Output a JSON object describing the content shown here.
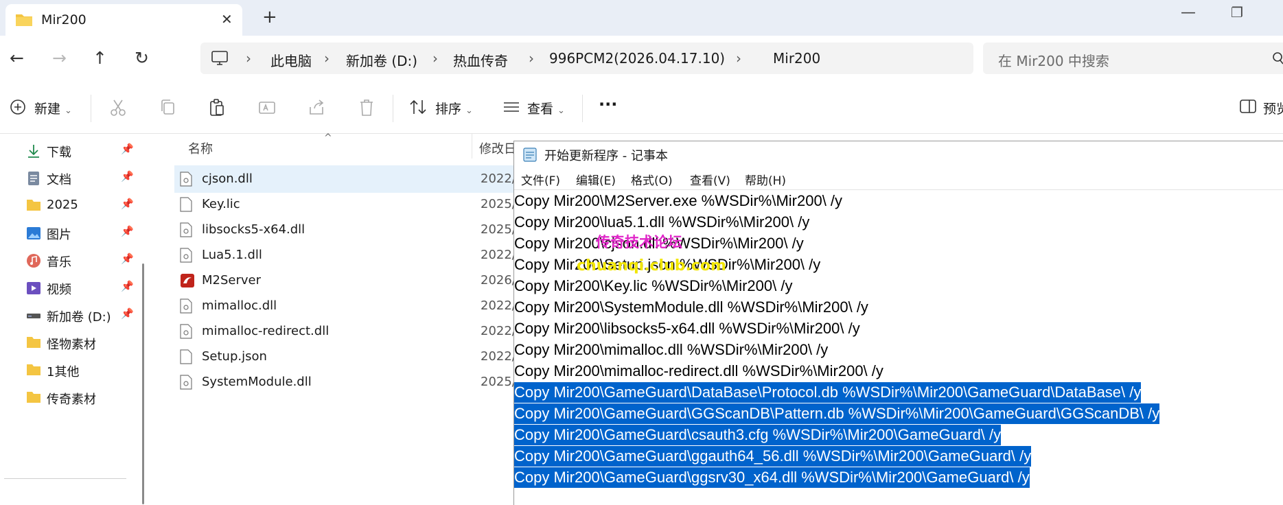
{
  "titlebar": {
    "tab_title": "Mir200",
    "tab_close": "✕",
    "new_tab": "+",
    "minimize": "—",
    "maximize": "❐"
  },
  "nav": {
    "back": "←",
    "forward": "→",
    "up": "↑",
    "refresh": "↻"
  },
  "breadcrumb": [
    "此电脑",
    "新加卷 (D:)",
    "热血传奇",
    "996PCM2(2026.04.17.10)",
    "Mir200"
  ],
  "breadcrumb_sep": "›",
  "search": {
    "placeholder": "在 Mir200 中搜索"
  },
  "toolbar": {
    "new_label": "新建",
    "sort_label": "排序",
    "view_label": "查看",
    "more_label": "···",
    "preview_label": "预览",
    "chevron": "⌄"
  },
  "sidebar": {
    "pin_glyph": "📌",
    "items": [
      {
        "label": "下载",
        "icon": "download-icon",
        "pinned": true
      },
      {
        "label": "文档",
        "icon": "document-icon",
        "pinned": true
      },
      {
        "label": "2025",
        "icon": "folder-icon",
        "pinned": true
      },
      {
        "label": "图片",
        "icon": "picture-icon",
        "pinned": true
      },
      {
        "label": "音乐",
        "icon": "music-icon",
        "pinned": true
      },
      {
        "label": "视频",
        "icon": "video-icon",
        "pinned": true
      },
      {
        "label": "新加卷 (D:)",
        "icon": "drive-icon",
        "pinned": true
      },
      {
        "label": "怪物素材",
        "icon": "folder-icon",
        "pinned": false
      },
      {
        "label": "1其他",
        "icon": "folder-icon",
        "pinned": false
      },
      {
        "label": "传奇素材",
        "icon": "folder-icon",
        "pinned": false
      }
    ]
  },
  "filelist": {
    "col_name": "名称",
    "col_date": "修改日",
    "sort_arrow": "^",
    "files": [
      {
        "name": "cjson.dll",
        "date": "2022/",
        "icon": "dll-file-icon",
        "selected": true
      },
      {
        "name": "Key.lic",
        "date": "2025/",
        "icon": "blank-file-icon",
        "selected": false
      },
      {
        "name": "libsocks5-x64.dll",
        "date": "2025/",
        "icon": "dll-file-icon",
        "selected": false
      },
      {
        "name": "Lua5.1.dll",
        "date": "2022/",
        "icon": "dll-file-icon",
        "selected": false
      },
      {
        "name": "M2Server",
        "date": "2026/",
        "icon": "m2server-app-icon",
        "selected": false
      },
      {
        "name": "mimalloc.dll",
        "date": "2022/",
        "icon": "dll-file-icon",
        "selected": false
      },
      {
        "name": "mimalloc-redirect.dll",
        "date": "2022/",
        "icon": "dll-file-icon",
        "selected": false
      },
      {
        "name": "Setup.json",
        "date": "2022/",
        "icon": "blank-file-icon",
        "selected": false
      },
      {
        "name": "SystemModule.dll",
        "date": "2025/",
        "icon": "dll-file-icon",
        "selected": false
      }
    ]
  },
  "notepad": {
    "title": "开始更新程序 - 记事本",
    "menu": [
      "文件(F)",
      "编辑(E)",
      "格式(O)",
      "查看(V)",
      "帮助(H)"
    ],
    "lines": [
      {
        "text": "Copy Mir200\\M2Server.exe %WSDir%\\Mir200\\ /y",
        "selected": false
      },
      {
        "text": "Copy Mir200\\lua5.1.dll %WSDir%\\Mir200\\ /y",
        "selected": false
      },
      {
        "text": "Copy Mir200\\cjson.dll %WSDir%\\Mir200\\ /y",
        "selected": false
      },
      {
        "text": "Copy Mir200\\Setup.json %WSDir%\\Mir200\\ /y",
        "selected": false
      },
      {
        "text": "Copy Mir200\\Key.lic %WSDir%\\Mir200\\ /y",
        "selected": false
      },
      {
        "text": "Copy Mir200\\SystemModule.dll %WSDir%\\Mir200\\ /y",
        "selected": false
      },
      {
        "text": "Copy Mir200\\libsocks5-x64.dll %WSDir%\\Mir200\\ /y",
        "selected": false
      },
      {
        "text": "Copy Mir200\\mimalloc.dll %WSDir%\\Mir200\\ /y",
        "selected": false
      },
      {
        "text": "Copy Mir200\\mimalloc-redirect.dll %WSDir%\\Mir200\\ /y",
        "selected": false
      },
      {
        "text": "Copy Mir200\\GameGuard\\DataBase\\Protocol.db %WSDir%\\Mir200\\GameGuard\\DataBase\\ /y",
        "selected": true
      },
      {
        "text": "Copy Mir200\\GameGuard\\GGScanDB\\Pattern.db %WSDir%\\Mir200\\GameGuard\\GGScanDB\\ /y",
        "selected": true
      },
      {
        "text": "Copy Mir200\\GameGuard\\csauth3.cfg %WSDir%\\Mir200\\GameGuard\\ /y",
        "selected": true
      },
      {
        "text": "Copy Mir200\\GameGuard\\ggauth64_56.dll %WSDir%\\Mir200\\GameGuard\\ /y",
        "selected": true
      },
      {
        "text": "Copy Mir200\\GameGuard\\ggsrv30_x64.dll %WSDir%\\Mir200\\GameGuard\\ /y",
        "selected": true
      }
    ]
  },
  "watermark": {
    "line1": "传奇技术论坛",
    "line2": "chuanqi.club.com"
  },
  "colors": {
    "selection": "#0063cc",
    "accent": "#0067c0",
    "folder": "#f4c542",
    "watermark_pink": "#e026c8",
    "watermark_yellow": "#f2e600"
  }
}
